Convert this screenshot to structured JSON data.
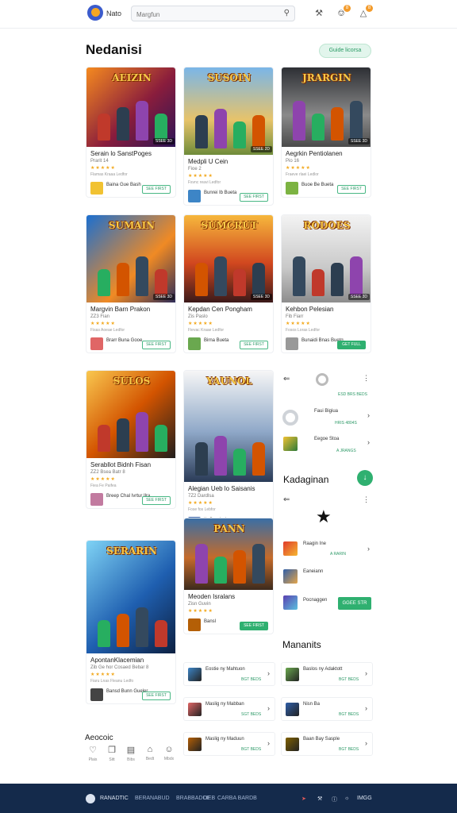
{
  "header": {
    "brand": "Nato",
    "search_placeholder": "Margfun",
    "notif_badge": "8",
    "cart_badge": "8"
  },
  "page_title": "Nedanisi",
  "pill_label": "Guide licorsa",
  "cards": [
    {
      "art_title": "AEIZIN",
      "tag": "SSEE 3D",
      "name": "Serain lo SanstPoges",
      "sub": "Prarit 14",
      "stars": "★★★★★",
      "meta": "Flamas Kraaa Ledfor",
      "dev": "Baina Gue Bash",
      "button": "SEE FIRST"
    },
    {
      "art_title": "SUSOIN",
      "tag": "SSEE 2D",
      "name": "Medpli U Cein",
      "sub": "Fioe 2",
      "stars": "★★★★★",
      "meta": "Fsvnc reavi Ledfor",
      "dev": "Bunrei Ib Bueta",
      "button": "SEE FIRST"
    },
    {
      "art_title": "JRARGIN",
      "tag": "SSEE 3D",
      "name": "Aegrkin Pentiolanen",
      "sub": "Pio 16",
      "stars": "★★★★★",
      "meta": "Fraeve rlaei Ledlor",
      "dev": "Buoe Be Bueta",
      "button": "SEE FIRST"
    },
    {
      "art_title": "SUMAIN",
      "tag": "SSEE 3D",
      "name": "Margvin Barn Prakon",
      "sub": "ZZ3 Fian",
      "stars": "★★★★★",
      "meta": "Fisas Aoeae Ledfor",
      "dev": "Brarr Buna Gooe",
      "button": "SEE FIRST"
    },
    {
      "art_title": "SUMCRUT",
      "tag": "SSEE 3D",
      "name": "Kepdan Cen Pongham",
      "sub": "Zis Paslo",
      "stars": "★★★★★",
      "meta": "Fievac Kraae Ledfor",
      "dev": "Birna Bueta",
      "button": "SEE FIRST"
    },
    {
      "art_title": "RODOES",
      "tag": "SSEE 3D",
      "name": "Kehbon Pelesian",
      "sub": "Fib Fiarr",
      "stars": "★★★★★",
      "meta": "Fosos Loras Ledfor",
      "dev": "Bunaidi Bnas Buetg",
      "button": "GET FULL"
    },
    {
      "art_title": "SULOS",
      "tag": "",
      "name": "Serabllot Bidnh Fisan",
      "sub": "ZZ2 Bsea Batr 8",
      "stars": "★★★★★",
      "meta": "Fiea Fe Paifea",
      "dev": "Breep Chal Ivrtur Ilra",
      "button": "SEE FIRST"
    },
    {
      "art_title": "YAUNOL",
      "tag": "",
      "name": "Alegian Ueb lo Saisanis",
      "sub": "7Z2 Dardlsa",
      "stars": "★★★★★",
      "meta": "Fose fos Lebfor",
      "dev": "Ib Gorebai",
      "button": "SEE FIRST"
    },
    {
      "art_title": "PANN",
      "tag": "",
      "name": "Meoden Isralans",
      "sub": "Zisn Guvin",
      "stars": "★★★★★",
      "meta": "",
      "dev": "Bansl",
      "button": "SEE FIRST"
    },
    {
      "art_title": "SERARIN",
      "tag": "",
      "name": "ApontanKlacemian",
      "sub": "Zib Ge hor Cosaed Bebar 8",
      "stars": "★★★★★",
      "meta": "Fiaru Lnas Fleanu Ledfo",
      "dev": "Bansd Bunn Gueler",
      "button": "SEE FIRST"
    }
  ],
  "side_top": [
    {
      "title": "Faui Bigiua",
      "sub": "HRIS 4804S"
    },
    {
      "title": "Eegoe Stoa",
      "sub": "A JRANGS"
    }
  ],
  "side_section": "Kadaginan",
  "side_list": [
    {
      "title": "Raagin Ine",
      "sub": "A RARIN"
    },
    {
      "title": "Eaneiann",
      "sub": ""
    },
    {
      "title": "Pocnaggen",
      "sub": ""
    }
  ],
  "side_button": "GGEE STR",
  "manants_title": "Mananits",
  "manants": [
    {
      "title": "Eostie ny Mahtuon",
      "sub": "BGT BEDS"
    },
    {
      "title": "Maslig ny Mabban",
      "sub": "SGT BEDS"
    },
    {
      "title": "Maslig ny Maduun",
      "sub": "BGT BEDS"
    },
    {
      "title": "Baslos ny Adaktott",
      "sub": "BGT BEDS"
    },
    {
      "title": "Nisn Ba",
      "sub": "BGT BEDS"
    },
    {
      "title": "Baan Bay Sasple",
      "sub": "BGT BEDS"
    }
  ],
  "bottom": {
    "label": "Aeocoic",
    "items": [
      "Plais",
      "Sitt",
      "Bibs",
      "Bedt",
      "Mbdx"
    ]
  },
  "footer": {
    "brand": "RANADTIC",
    "links": [
      "BERANABUD",
      "BRABBADOE",
      "LIEB",
      "CARBA BARDB"
    ],
    "right": "IMGG"
  },
  "colors": {
    "accent": "#2fb070",
    "footer": "#142a4b",
    "stars": "#f2a81d"
  }
}
